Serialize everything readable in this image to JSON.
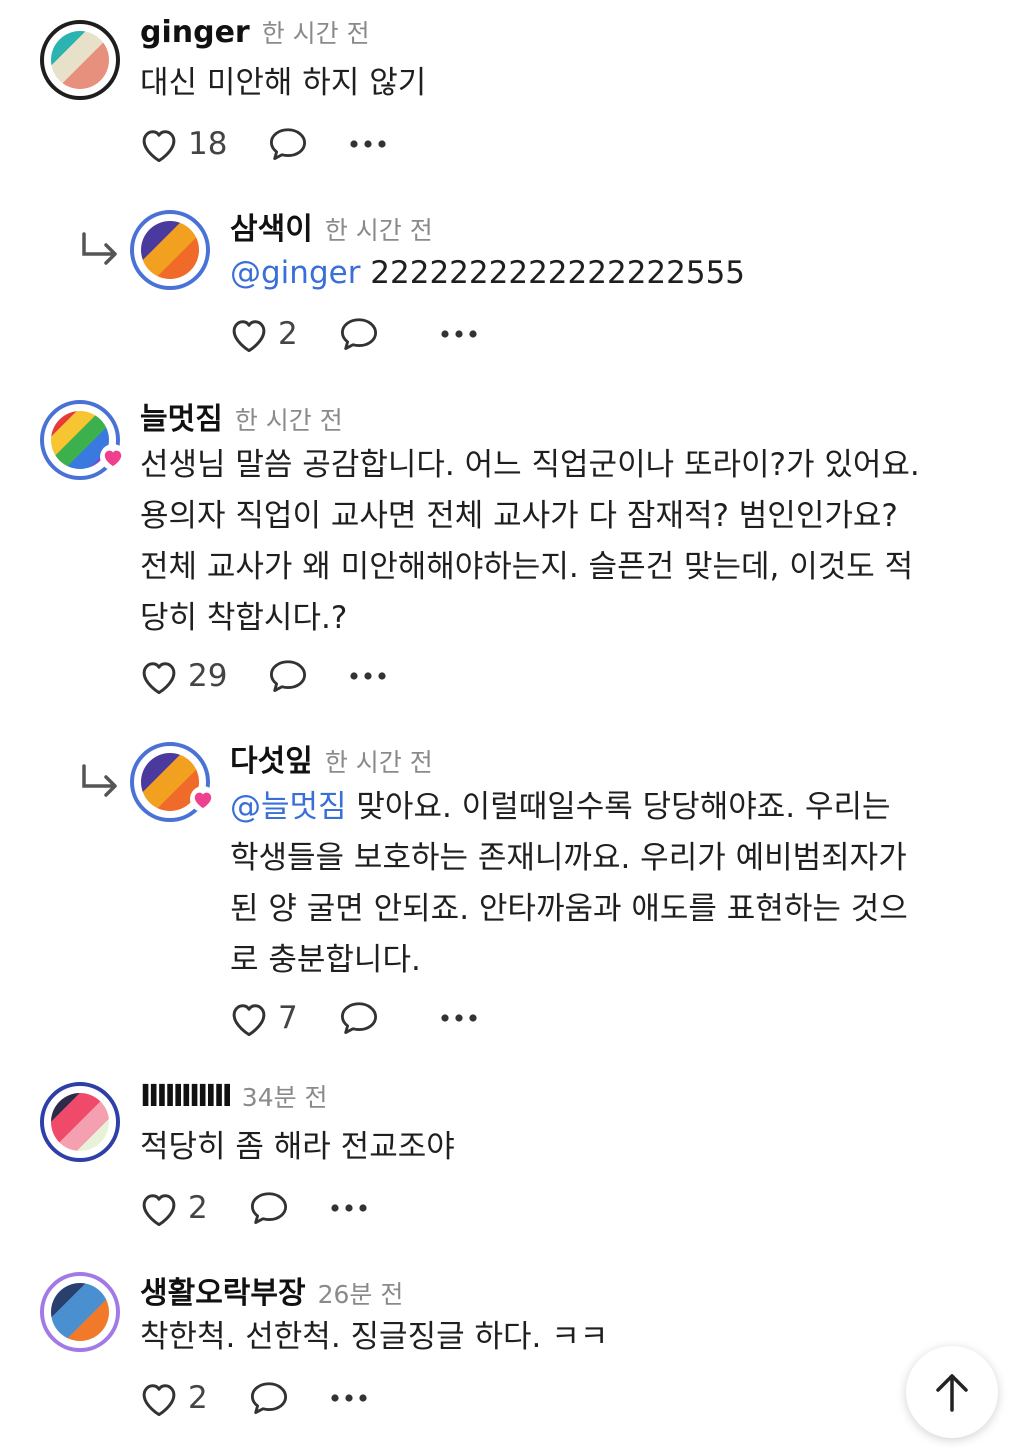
{
  "comments": [
    {
      "author": "ginger",
      "time": "한 시간 전",
      "text_lines": [
        "대신 미안해 하지 않기"
      ],
      "likes": "18",
      "avatar_colors": [
        "#2ab3b0",
        "#e8e1c9",
        "#e8907e"
      ]
    },
    {
      "author": "삼색이",
      "time": "한 시간 전",
      "mention": "@ginger",
      "text_lines": [
        " 2222222222222222555"
      ],
      "likes": "2",
      "avatar_colors": [
        "#4b3a9e",
        "#f2a01f",
        "#f06a2a"
      ]
    },
    {
      "author": "늘멋짐",
      "time": "한 시간 전",
      "text_lines": [
        "선생님 말씀 공감합니다. 어느 직업군이나 또라이?가 있어요.",
        "용의자 직업이 교사면 전체 교사가 다 잠재적? 범인인가요?",
        "전체 교사가 왜 미안해해야하는지. 슬픈건 맞는데, 이것도 적",
        "당히 착합시다.?"
      ],
      "likes": "29",
      "avatar_colors": [
        "#e63b3b",
        "#f7c531",
        "#3bb04d",
        "#3a7ae0"
      ]
    },
    {
      "author": "다섯잎",
      "time": "한 시간 전",
      "mention": "@늘멋짐",
      "text_lines": [
        " 맞아요. 이럴때일수록 당당해야죠. 우리는",
        "학생들을 보호하는 존재니까요. 우리가 예비범죄자가",
        "된 양 굴면 안되죠. 안타까움과 애도를 표현하는 것으",
        "로 충분합니다."
      ],
      "likes": "7",
      "avatar_colors": [
        "#4b3a9e",
        "#f2a01f",
        "#f06a2a"
      ]
    },
    {
      "author": "IIIIIIIIIII",
      "time": "34분 전",
      "text_lines": [
        "적당히 좀 해라 전교조야"
      ],
      "likes": "2",
      "avatar_colors": [
        "#2c2c4a",
        "#ef4a6a",
        "#f4a0b0",
        "#e8f2d8"
      ]
    },
    {
      "author": "생활오락부장",
      "time": "26분 전",
      "text_lines": [
        "착한척. 선한척. 징글징글 하다. ㅋㅋ"
      ],
      "likes": "2",
      "avatar_colors": [
        "#2a3f6e",
        "#4a90d0",
        "#f07a2a"
      ]
    }
  ],
  "colors": {
    "mention": "#3a6fd8",
    "badge_heart": "#ef3f8f",
    "avatar_ring_blue": "#4a72d6",
    "avatar_ring_purple": "#a07be6"
  },
  "icons": [
    "heart-icon",
    "comment-bubble-icon",
    "more-dots-icon",
    "reply-arrow-icon",
    "arrow-up-icon"
  ]
}
